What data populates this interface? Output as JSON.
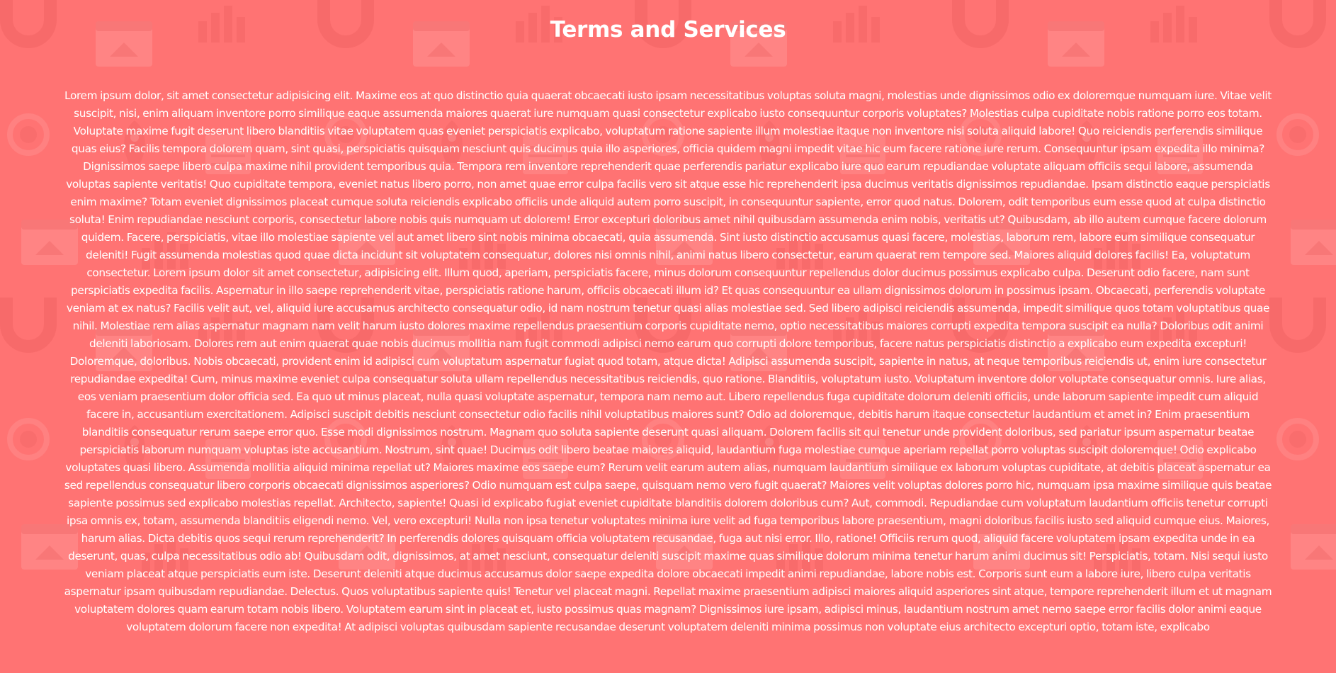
{
  "page": {
    "title": "Terms and Services",
    "body_text": "Lorem ipsum dolor, sit amet consectetur adipisicing elit. Maxime eos at quo distinctio quia quaerat obcaecati iusto ipsam necessitatibus voluptas soluta magni, molestias unde dignissimos odio ex doloremque numquam iure. Vitae velit suscipit, nisi, enim aliquam inventore porro similique eaque assumenda maiores quaerat iure numquam quasi consectetur explicabo iusto consequuntur corporis voluptates? Molestias culpa cupiditate nobis ratione porro eos totam. Voluptate maxime fugit deserunt libero blanditiis vitae voluptatem quas eveniet perspiciatis explicabo, voluptatum ratione sapiente illum molestiae itaque non inventore nisi soluta aliquid labore! Quo reiciendis perferendis similique quas eius? Facilis tempora dolorem quam, sint quasi, perspiciatis quisquam nesciunt quis ducimus quia illo asperiores, officia quidem magni impedit vitae hic eum facere ratione iure rerum. Consequuntur ipsam expedita illo minima? Dignissimos saepe libero culpa maxime nihil provident temporibus quia. Tempora rem inventore reprehenderit quae perferendis pariatur explicabo iure quo earum repudiandae voluptate aliquam officiis sequi labore, assumenda voluptas sapiente veritatis! Quo cupiditate tempora, eveniet natus libero porro, non amet quae error culpa facilis vero sit atque esse hic reprehenderit ipsa ducimus veritatis dignissimos repudiandae. Ipsam distinctio eaque perspiciatis enim maxime? Totam eveniet dignissimos placeat cumque soluta reiciendis explicabo officiis unde aliquid autem porro suscipit, in consequuntur sapiente, error quod natus. Dolorem, odit temporibus eum esse quod at culpa distinctio soluta! Enim repudiandae nesciunt corporis, consectetur labore nobis quis numquam ut dolorem! Error excepturi doloribus amet nihil quibusdam assumenda enim nobis, veritatis ut? Quibusdam, ab illo autem cumque facere dolorum quidem. Facere, perspiciatis, vitae illo molestiae sapiente vel aut amet libero sint nobis minima obcaecati, quia assumenda. Sint iusto distinctio accusamus quasi facere, molestias, laborum rem, labore eum similique consequatur deleniti! Fugit assumenda molestias quod quae dicta incidunt sit voluptatem consequatur, dolores nisi omnis nihil, animi natus libero consectetur, earum quaerat rem tempore sed. Maiores aliquid dolores facilis! Ea, voluptatum consectetur. Lorem ipsum dolor sit amet consectetur, adipisicing elit. Illum quod, aperiam, perspiciatis facere, minus dolorum consequuntur repellendus dolor ducimus possimus explicabo culpa. Deserunt odio facere, nam sunt perspiciatis expedita facilis. Aspernatur in illo saepe reprehenderit vitae, perspiciatis ratione harum, officiis obcaecati illum id? Et quas consequuntur ea ullam dignissimos dolorum in possimus ipsam. Obcaecati, perferendis voluptate veniam at ex natus? Facilis velit aut, vel, aliquid iure accusamus architecto consequatur odio, id nam nostrum tenetur quasi alias molestiae sed. Sed libero adipisci reiciendis assumenda, impedit similique quos totam voluptatibus quae nihil. Molestiae rem alias aspernatur magnam nam velit harum iusto dolores maxime repellendus praesentium corporis cupiditate nemo, optio necessitatibus maiores corrupti expedita tempora suscipit ea nulla? Doloribus odit animi deleniti laboriosam. Dolores rem aut enim quaerat quae nobis ducimus mollitia nam fugit commodi adipisci nemo earum quo corrupti dolore temporibus, facere natus perspiciatis distinctio a explicabo eum expedita excepturi! Doloremque, doloribus. Nobis obcaecati, provident enim id adipisci cum voluptatum aspernatur fugiat quod totam, atque dicta! Adipisci assumenda suscipit, sapiente in natus, at neque temporibus reiciendis ut, enim iure consectetur repudiandae expedita! Cum, minus maxime eveniet culpa consequatur soluta ullam repellendus necessitatibus reiciendis, quo ratione. Blanditiis, voluptatum iusto. Voluptatum inventore dolor voluptate consequatur omnis. Iure alias, eos veniam praesentium dolor officia sed. Ea quo ut minus placeat, nulla quasi voluptate aspernatur, tempora nam nemo aut. Libero repellendus fuga cupiditate dolorum deleniti officiis, unde laborum sapiente impedit cum aliquid facere in, accusantium exercitationem. Adipisci suscipit debitis nesciunt consectetur odio facilis nihil voluptatibus maiores sunt? Odio ad doloremque, debitis harum itaque consectetur laudantium et amet in? Enim praesentium blanditiis consequatur rerum saepe error quo. Esse modi dignissimos nostrum. Magnam quo soluta sapiente deserunt quasi aliquam. Dolorem facilis sit qui tenetur unde provident doloribus, sed pariatur ipsum aspernatur beatae perspiciatis laborum numquam voluptas iste accusantium. Nostrum, sint quae! Ducimus odit libero beatae maiores aliquid, laudantium fuga molestiae cumque aperiam repellat porro voluptas suscipit doloremque! Odio explicabo voluptates quasi libero. Assumenda mollitia aliquid minima repellat ut? Maiores maxime eos saepe eum? Rerum velit earum autem alias, numquam laudantium similique ex laborum voluptas cupiditate, at debitis placeat aspernatur ea sed repellendus consequatur libero corporis obcaecati dignissimos asperiores? Odio numquam est culpa saepe, quisquam nemo vero fugit quaerat? Maiores velit voluptas dolores porro hic, numquam ipsa maxime similique quis beatae sapiente possimus sed explicabo molestias repellat. Architecto, sapiente! Quasi id explicabo fugiat eveniet cupiditate blanditiis dolorem doloribus cum? Aut, commodi. Repudiandae cum voluptatum laudantium officiis tenetur corrupti ipsa omnis ex, totam, assumenda blanditiis eligendi nemo. Vel, vero excepturi! Nulla non ipsa tenetur voluptates minima iure velit ad fuga temporibus labore praesentium, magni doloribus facilis iusto sed aliquid cumque eius. Maiores, harum alias. Dicta debitis quos sequi rerum reprehenderit? In perferendis dolores quisquam officia voluptatem recusandae, fuga aut nisi error. Illo, ratione! Officiis rerum quod, aliquid facere voluptatem ipsam expedita unde in ea deserunt, quas, culpa necessitatibus odio ab! Quibusdam odit, dignissimos, at amet nesciunt, consequatur deleniti suscipit maxime quas similique dolorum minima tenetur harum animi ducimus sit! Perspiciatis, totam. Nisi sequi iusto veniam placeat atque perspiciatis eum iste. Deserunt deleniti atque ducimus accusamus dolor saepe expedita dolore obcaecati impedit animi repudiandae, labore nobis est. Corporis sunt eum a labore iure, libero culpa veritatis aspernatur ipsam quibusdam repudiandae. Delectus. Quos voluptatibus sapiente quis! Tenetur vel placeat magni. Repellat maxime praesentium adipisci maiores aliquid asperiores sint atque, tempore reprehenderit illum et ut magnam voluptatem dolores quam earum totam nobis libero. Voluptatem earum sint in placeat et, iusto possimus quas magnam? Dignissimos iure ipsam, adipisci minus, laudantium nostrum amet nemo saepe error facilis dolor animi eaque voluptatem dolorum facere non expedita! At adipisci voluptas quibusdam sapiente recusandae deserunt voluptatem deleniti minima possimus non voluptate eius architecto excepturi optio, totam iste, explicabo"
  },
  "colors": {
    "background": "#ff7373",
    "text": "#ffffff",
    "pattern_light": "#ffffff",
    "pattern_dark": "#e85a5a"
  },
  "background_icons": [
    "magnet-icon",
    "headset-icon",
    "chart-icon",
    "browser-window-icon",
    "rocket-icon",
    "gear-icon",
    "calendar-icon",
    "thumbs-up-icon"
  ]
}
